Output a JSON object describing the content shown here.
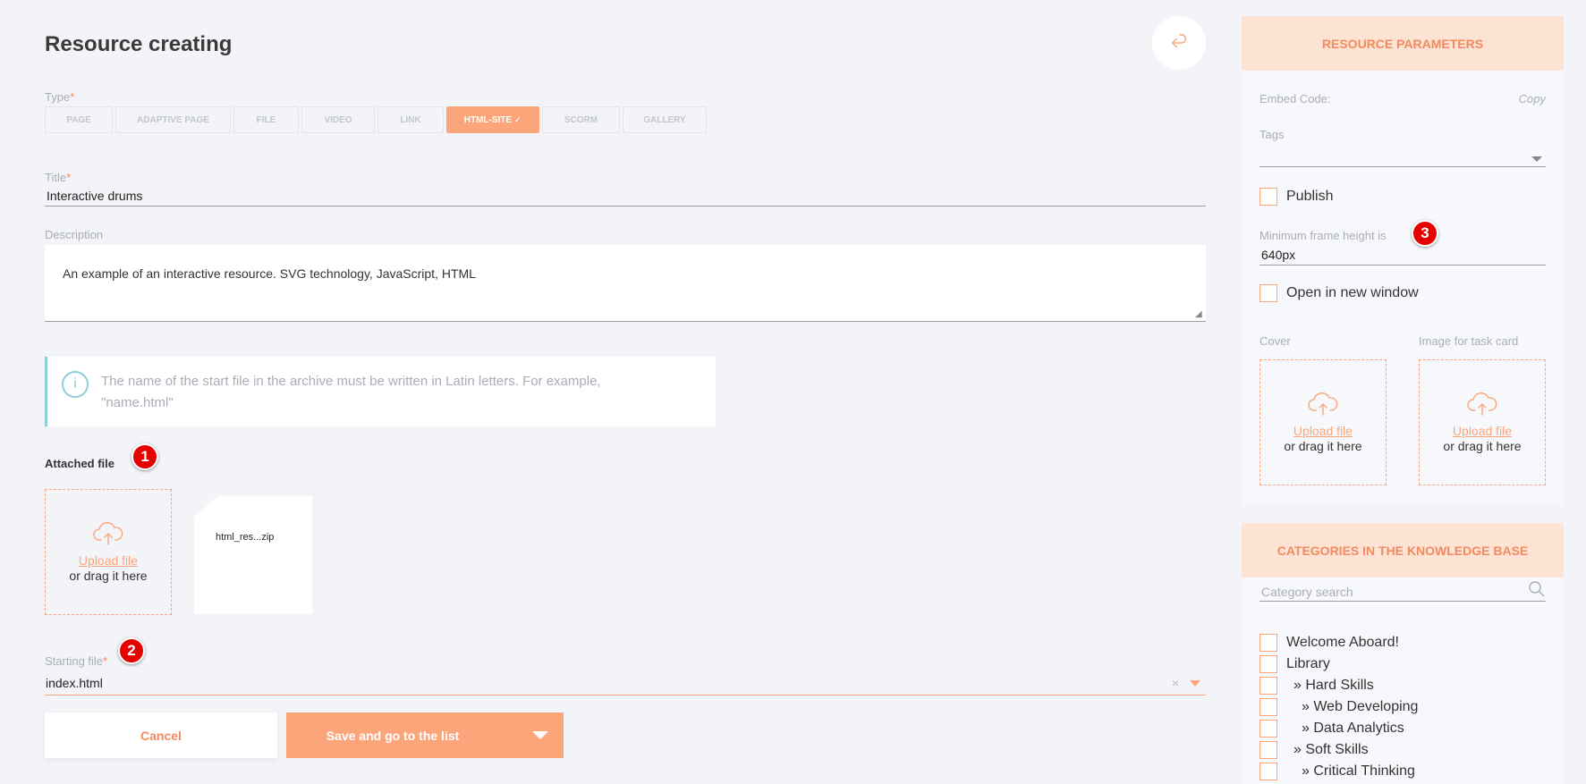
{
  "page": {
    "title": "Resource creating"
  },
  "type_field": {
    "label": "Type",
    "required_mark": "*",
    "options": [
      "PAGE",
      "ADAPTIVE PAGE",
      "FILE",
      "VIDEO",
      "LINK",
      "HTML-SITE ✓",
      "SCORM",
      "GALLERY"
    ],
    "selected": "HTML-SITE"
  },
  "title_field": {
    "label": "Title",
    "required_mark": "*",
    "value": "Interactive drums"
  },
  "description_field": {
    "label": "Description",
    "value": "An example of an interactive resource. SVG technology, JavaScript, HTML"
  },
  "info": {
    "icon": "info-icon",
    "glyph": "i",
    "text_line1": "The name of the start file in the archive must be written in Latin letters. For example,",
    "text_line2": "\"name.html\""
  },
  "attached": {
    "heading": "Attached file",
    "upload_link": "Upload file",
    "upload_sub": "or drag it here",
    "file_name": "html_res...zip"
  },
  "starting_file": {
    "label": "Starting file",
    "required_mark": "*",
    "value": "index.html",
    "clear": "×"
  },
  "actions": {
    "cancel": "Cancel",
    "save": "Save and go to the list"
  },
  "badges": {
    "one": "1",
    "two": "2",
    "three": "3"
  },
  "params_panel": {
    "heading": "RESOURCE PARAMETERS",
    "embed_label": "Embed Code:",
    "copy_label": "Copy",
    "tags_label": "Tags",
    "publish_label": "Publish",
    "min_height_label": "Minimum frame height is",
    "min_height_value": "640px",
    "new_window_label": "Open in new window",
    "cover_label": "Cover",
    "task_card_label": "Image for task card",
    "upload_link": "Upload file",
    "upload_sub": "or drag it here"
  },
  "categories_panel": {
    "heading": "CATEGORIES IN THE KNOWLEDGE BASE",
    "search_placeholder": "Category search",
    "items": [
      "Welcome Aboard!",
      "Library",
      "» Hard Skills",
      "» Web Developing",
      "» Data Analytics",
      "» Soft Skills",
      "» Critical Thinking"
    ]
  },
  "colors": {
    "accent": "#fca57b",
    "accent_dark": "#f28a5f",
    "info": "#8ccfd9",
    "badge": "#e60000"
  }
}
